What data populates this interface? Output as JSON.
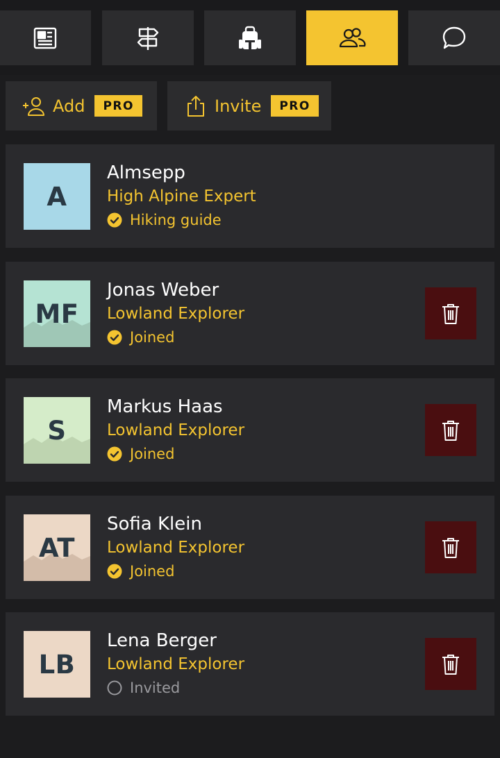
{
  "nav": {
    "tabs": [
      {
        "icon": "newspaper-icon",
        "active": false
      },
      {
        "icon": "signpost-icon",
        "active": false
      },
      {
        "icon": "backpack-icon",
        "active": false
      },
      {
        "icon": "people-icon",
        "active": true
      },
      {
        "icon": "chat-bubble-icon",
        "active": false
      }
    ]
  },
  "actions": {
    "add_label": "Add",
    "add_badge": "PRO",
    "invite_label": "Invite",
    "invite_badge": "PRO"
  },
  "members": [
    {
      "initials": "A",
      "name": "Almsepp",
      "role": "High Alpine Expert",
      "status": "Hiking guide",
      "status_type": "verified",
      "avatar_color": "#a8d8e8",
      "removable": false
    },
    {
      "initials": "MF",
      "name": "Jonas Weber",
      "role": "Lowland Explorer",
      "status": "Joined",
      "status_type": "joined",
      "avatar_color": "#b5e3d3",
      "removable": true
    },
    {
      "initials": "S",
      "name": "Markus Haas",
      "role": "Lowland Explorer",
      "status": "Joined",
      "status_type": "joined",
      "avatar_color": "#d5ecc9",
      "removable": true
    },
    {
      "initials": "AT",
      "name": "Sofia Klein",
      "role": "Lowland Explorer",
      "status": "Joined",
      "status_type": "joined",
      "avatar_color": "#ecd8c6",
      "removable": true
    },
    {
      "initials": "LB",
      "name": "Lena Berger",
      "role": "Lowland Explorer",
      "status": "Invited",
      "status_type": "invited",
      "avatar_color": "#ecd8c6",
      "removable": true
    }
  ],
  "colors": {
    "accent": "#f4c430",
    "background": "#1c1c1e",
    "card": "#2a2a2d",
    "delete_bg": "#4a0e10",
    "muted": "#9a9a9e"
  }
}
